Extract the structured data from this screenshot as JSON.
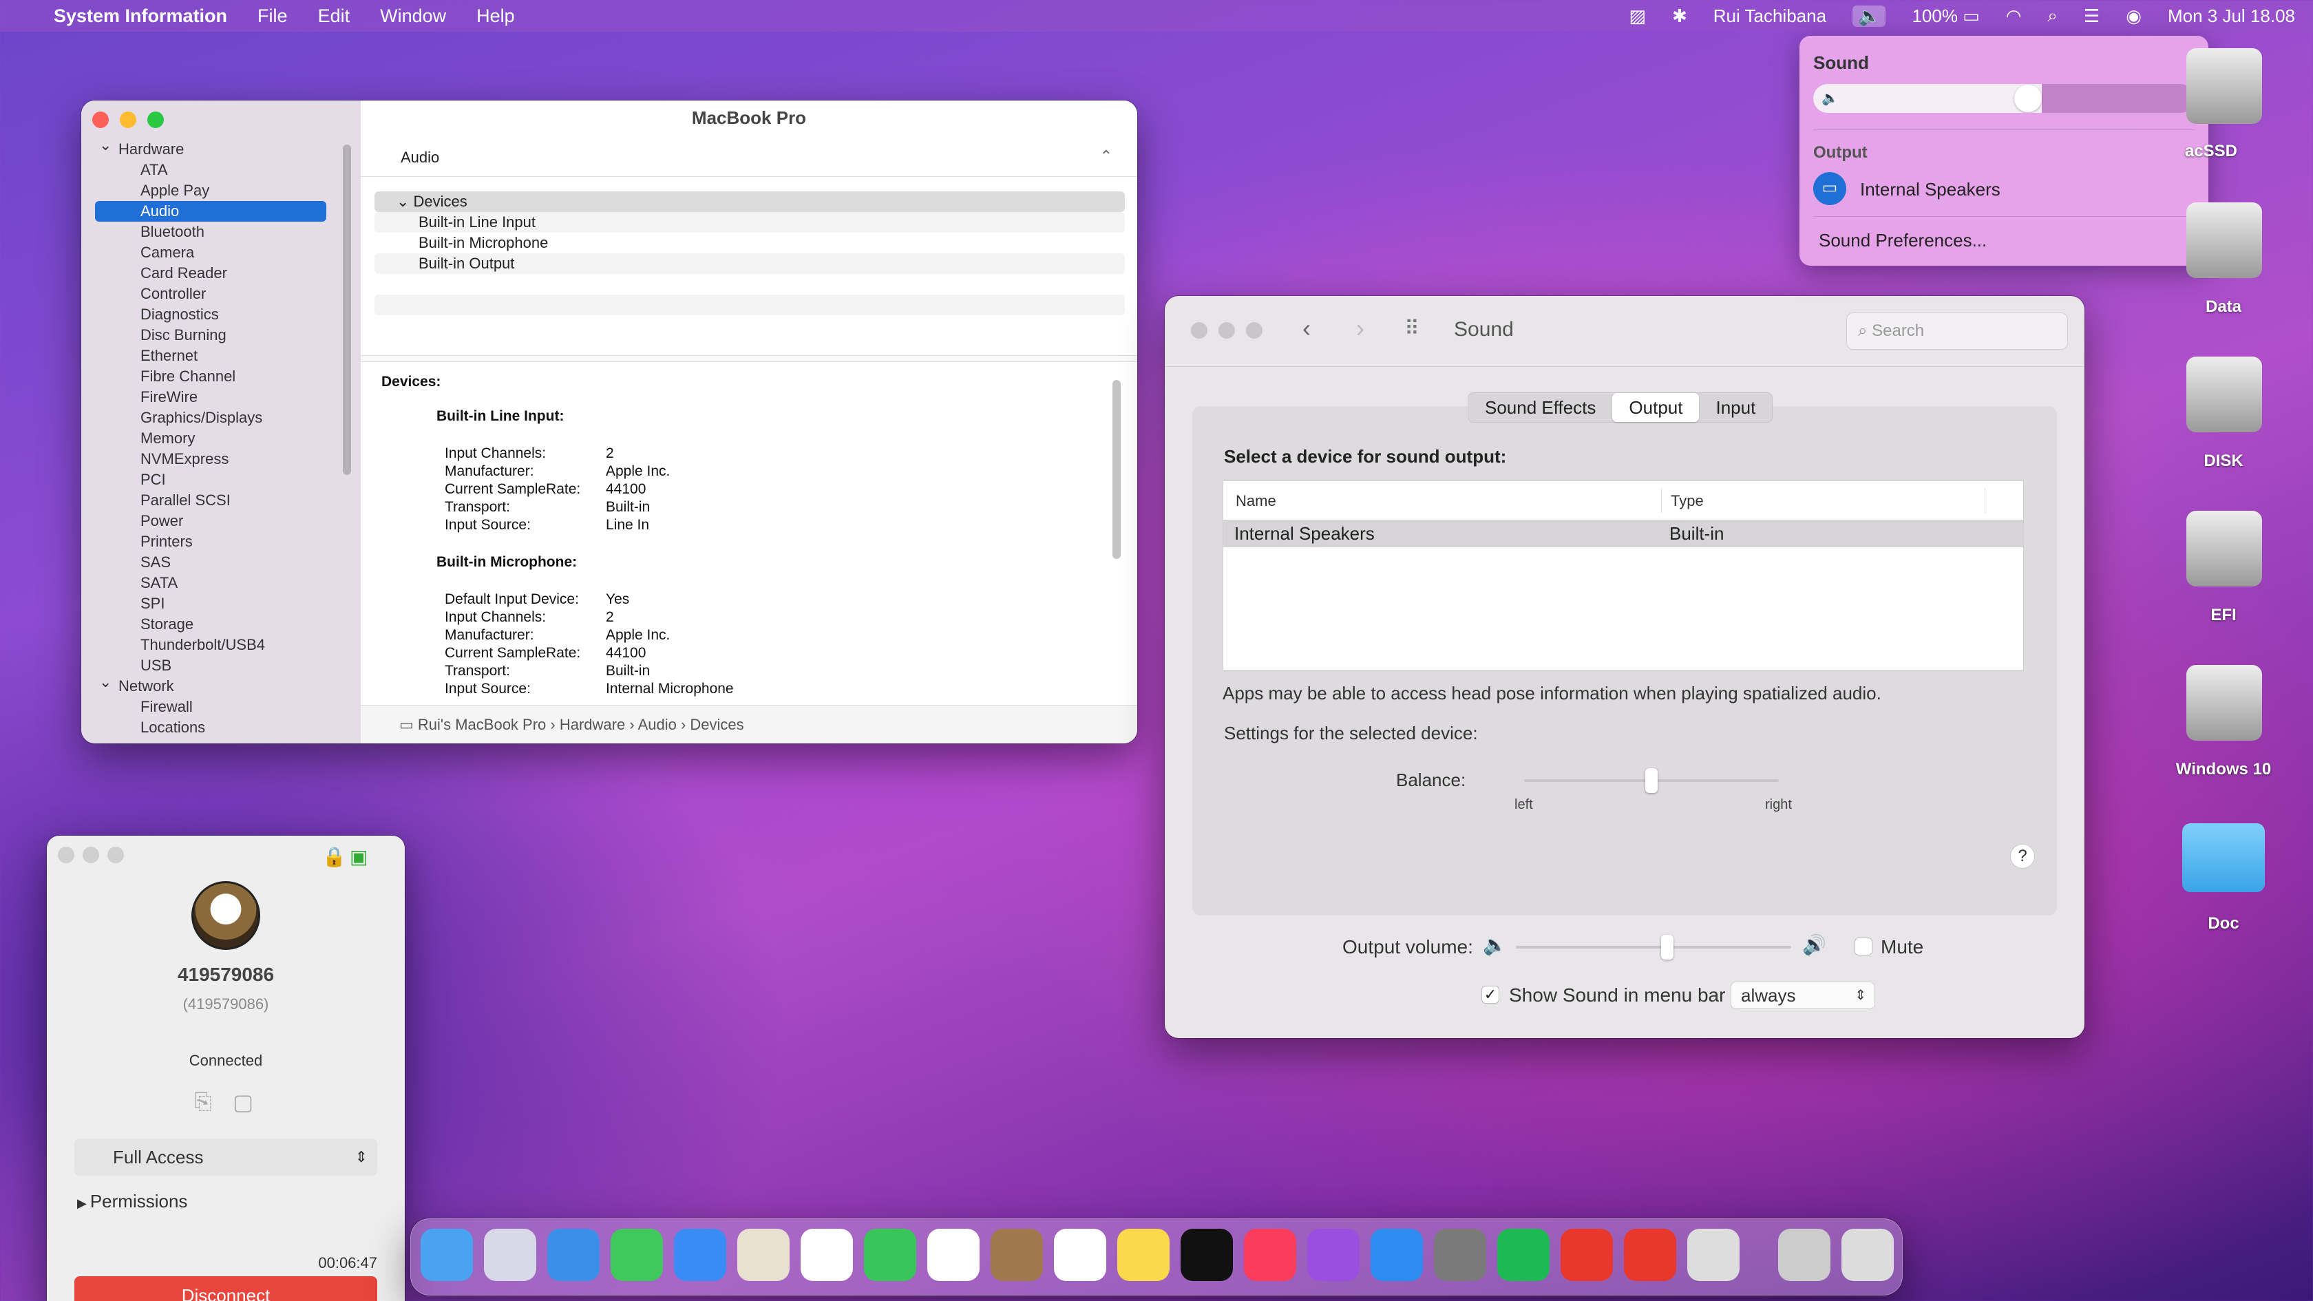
{
  "menubar": {
    "app": "System Information",
    "menus": [
      "File",
      "Edit",
      "Window",
      "Help"
    ],
    "user": "Rui Tachibana",
    "battery": "100%",
    "datetime": "Mon 3 Jul  18.08"
  },
  "sysinfo": {
    "title": "MacBook Pro",
    "header": "Audio",
    "sidebar": {
      "hardware": "Hardware",
      "items": [
        "ATA",
        "Apple Pay",
        "Audio",
        "Bluetooth",
        "Camera",
        "Card Reader",
        "Controller",
        "Diagnostics",
        "Disc Burning",
        "Ethernet",
        "Fibre Channel",
        "FireWire",
        "Graphics/Displays",
        "Memory",
        "NVMExpress",
        "PCI",
        "Parallel SCSI",
        "Power",
        "Printers",
        "SAS",
        "SATA",
        "SPI",
        "Storage",
        "Thunderbolt/USB4",
        "USB"
      ],
      "network": "Network",
      "network_items": [
        "Firewall",
        "Locations"
      ]
    },
    "tree": {
      "head": "Devices",
      "rows": [
        "Built-in Line Input",
        "Built-in Microphone",
        "Built-in Output"
      ]
    },
    "detail": {
      "heading": "Devices:",
      "line_input": {
        "title": "Built-in Line Input:",
        "rows": [
          [
            "Input Channels:",
            "2"
          ],
          [
            "Manufacturer:",
            "Apple Inc."
          ],
          [
            "Current SampleRate:",
            "44100"
          ],
          [
            "Transport:",
            "Built-in"
          ],
          [
            "Input Source:",
            "Line In"
          ]
        ]
      },
      "microphone": {
        "title": "Built-in Microphone:",
        "rows": [
          [
            "Default Input Device:",
            "Yes"
          ],
          [
            "Input Channels:",
            "2"
          ],
          [
            "Manufacturer:",
            "Apple Inc."
          ],
          [
            "Current SampleRate:",
            "44100"
          ],
          [
            "Transport:",
            "Built-in"
          ],
          [
            "Input Source:",
            "Internal Microphone"
          ]
        ]
      }
    },
    "path": [
      "Rui's MacBook Pro",
      "Hardware",
      "Audio",
      "Devices"
    ]
  },
  "sound": {
    "title": "Sound",
    "search_placeholder": "Search",
    "tabs": [
      "Sound Effects",
      "Output",
      "Input"
    ],
    "select_label": "Select a device for sound output:",
    "col_name": "Name",
    "col_type": "Type",
    "device_name": "Internal Speakers",
    "device_type": "Built-in",
    "spatial_note": "Apps may be able to access head pose information when playing spatialized audio.",
    "settings_label": "Settings for the selected device:",
    "balance_label": "Balance:",
    "left": "left",
    "right": "right",
    "balance": 0.5,
    "help": "?",
    "output_volume_label": "Output volume:",
    "output_volume": 0.55,
    "mute": "Mute",
    "show_in_menubar": "Show Sound in menu bar",
    "menubar_option": "always"
  },
  "soundmenu": {
    "title": "Sound",
    "volume": 0.6,
    "output_label": "Output",
    "device": "Internal Speakers",
    "prefs": "Sound Preferences..."
  },
  "remote": {
    "id": "419579086",
    "id_paren": "(419579086)",
    "status": "Connected",
    "access": "Full Access",
    "permissions": "Permissions",
    "timer": "00:06:47",
    "disconnect": "Disconnect"
  },
  "desktop": {
    "disks": [
      "acSSD",
      "Data",
      "DISK",
      "EFI",
      "Windows 10",
      "Doc"
    ]
  }
}
